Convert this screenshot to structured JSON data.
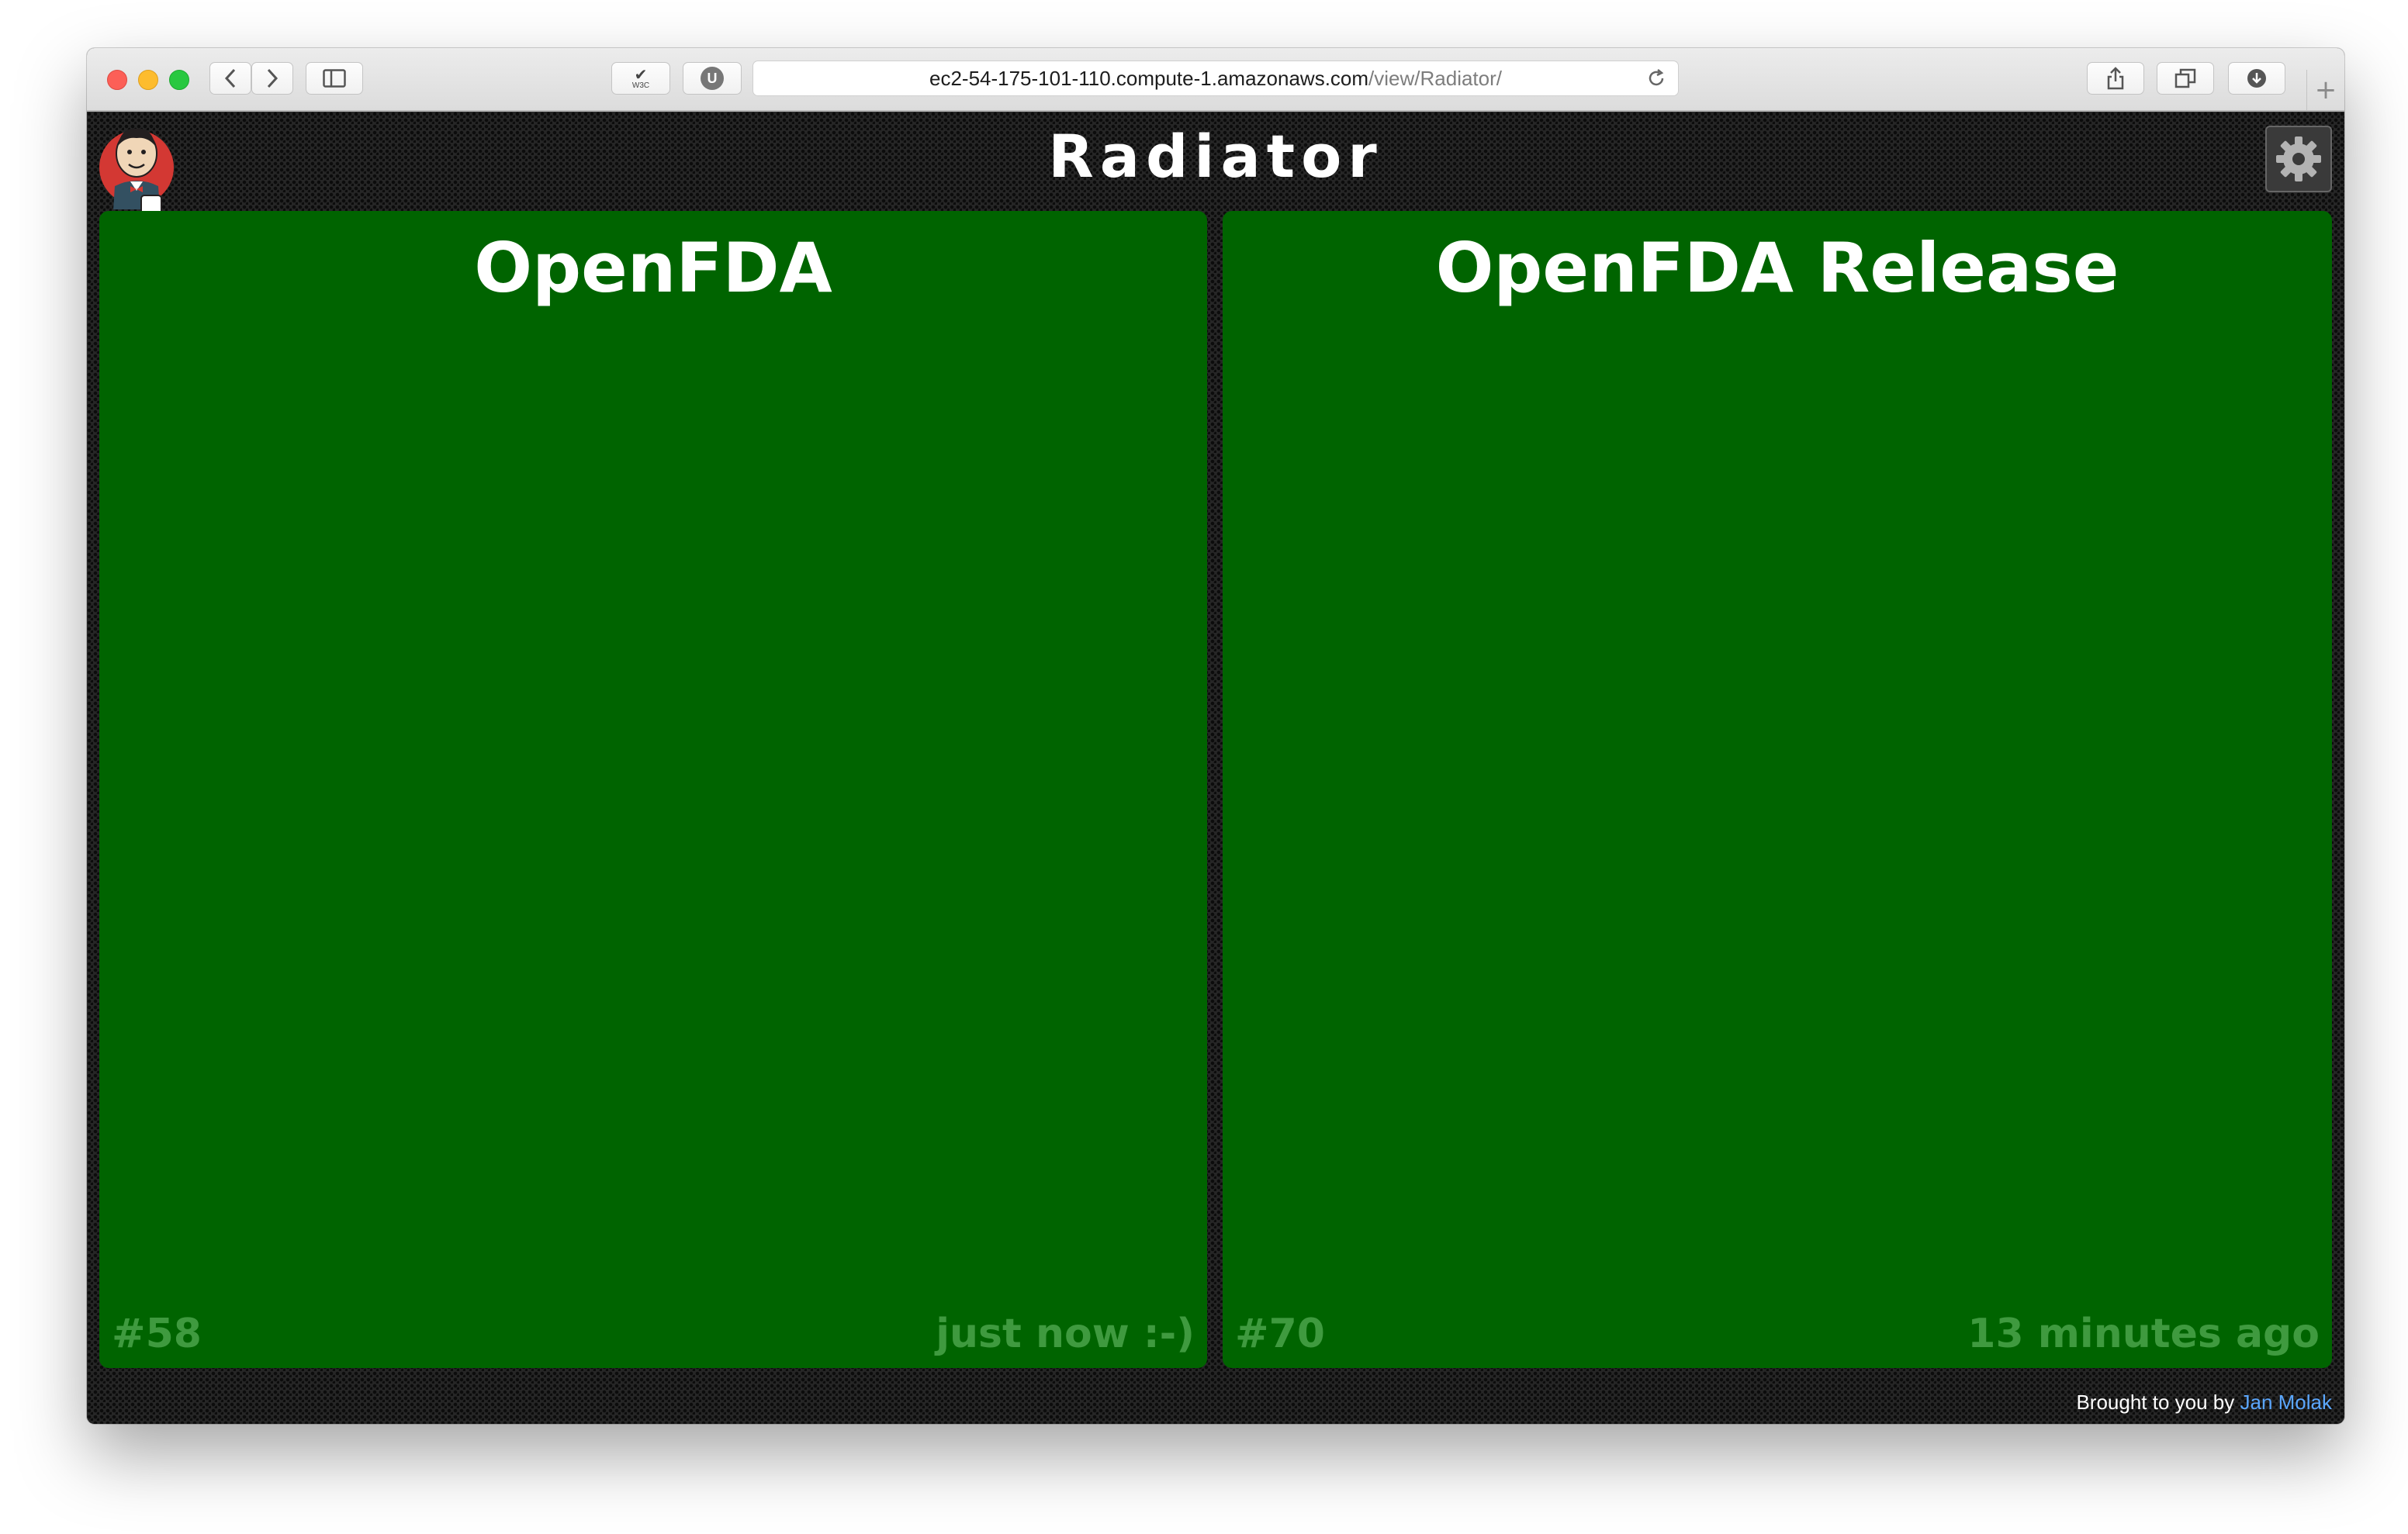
{
  "browser": {
    "url_host": "ec2-54-175-101-110.compute-1.amazonaws.com",
    "url_path": "/view/Radiator/",
    "w3c_label": "W3C",
    "u_label": "U",
    "newtab_label": "+"
  },
  "page": {
    "title": "Radiator",
    "footer_prefix": "Brought to you by",
    "footer_link": "Jan Molak"
  },
  "jobs": [
    {
      "name": "OpenFDA",
      "number": "#58",
      "time": "just now :-)",
      "status_color": "#006400"
    },
    {
      "name": "OpenFDA Release",
      "number": "#70",
      "time": "13 minutes ago",
      "status_color": "#006400"
    }
  ],
  "icons": {
    "back": "chevron-left-icon",
    "forward": "chevron-right-icon",
    "sidebar": "sidebar-icon",
    "reload": "reload-icon",
    "share": "share-icon",
    "tabs": "tabs-icon",
    "download": "download-icon",
    "settings": "gear-icon",
    "logo": "jenkins-logo"
  }
}
